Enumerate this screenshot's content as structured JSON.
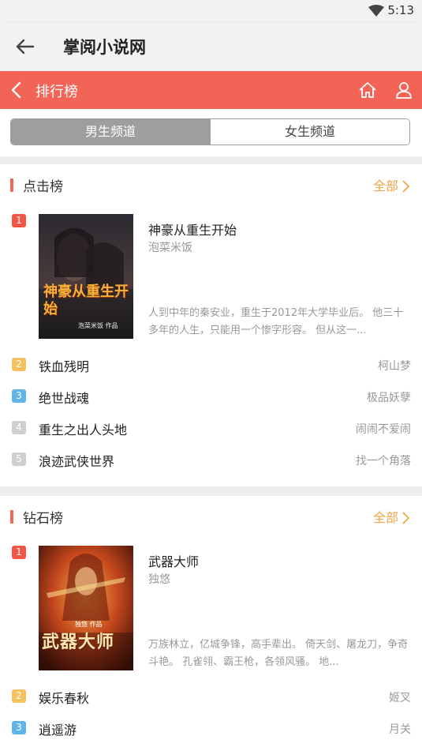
{
  "status": {
    "time": "5:13",
    "wifi_icon": "wifi-icon"
  },
  "appbar": {
    "title": "掌阅小说网",
    "back_icon": "arrow-left-icon"
  },
  "nav": {
    "title": "排行榜",
    "accent": "#f26556",
    "icons": [
      "chevron-left-icon",
      "home-icon",
      "user-icon"
    ]
  },
  "tabs": [
    {
      "label": "男生频道",
      "active": true
    },
    {
      "label": "女生频道",
      "active": false
    }
  ],
  "sections": [
    {
      "name": "点击榜",
      "all_label": "全部",
      "featured": {
        "rank": "1",
        "title": "神豪从重生开始",
        "author": "泡菜米饭",
        "description": "人到中年的秦安业，重生于2012年大学毕业后。 他三十多年的人生，只能用一个惨字形容。 但从这一...",
        "cover_text": "神豪从重生开始",
        "cover_sub": "泡菜米饭 作品"
      },
      "items": [
        {
          "rank": "2",
          "title": "铁血残明",
          "author": "柯山梦"
        },
        {
          "rank": "3",
          "title": "绝世战魂",
          "author": "极品妖孽"
        },
        {
          "rank": "4",
          "title": "重生之出人头地",
          "author": "闹闹不爱闹"
        },
        {
          "rank": "5",
          "title": "浪迹武侠世界",
          "author": "找一个角落"
        }
      ]
    },
    {
      "name": "钻石榜",
      "all_label": "全部",
      "featured": {
        "rank": "1",
        "title": "武器大师",
        "author": "独悠",
        "description": "万族林立，亿城争锋，高手辈出。 倚天剑、屠龙刀，争奇斗艳。 孔雀翎、霸王枪，各领风骚。 地...",
        "cover_text": "武器大师",
        "cover_sub": "独悠 作品"
      },
      "items": [
        {
          "rank": "2",
          "title": "娱乐春秋",
          "author": "姬叉"
        },
        {
          "rank": "3",
          "title": "逍遥游",
          "author": "月关"
        }
      ]
    }
  ]
}
